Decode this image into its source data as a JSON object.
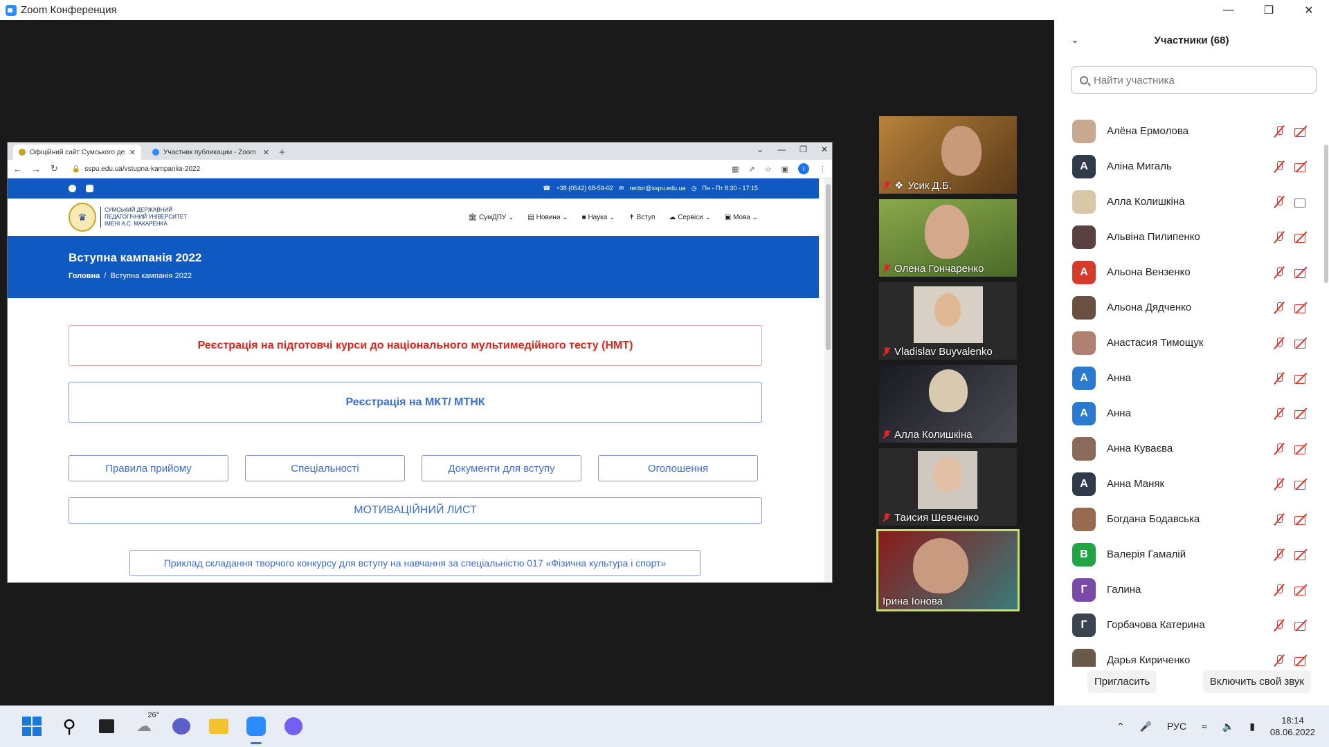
{
  "zoom": {
    "window_title": "Zoom Конференция"
  },
  "browser": {
    "tabs": [
      {
        "title": "Офіційний сайт Сумського держ",
        "color": "#c9a227"
      },
      {
        "title": "Участник публикации - Zoom",
        "color": "#2d8cff"
      }
    ],
    "url": "sspu.edu.ua/vstupna-kampaniia-2022",
    "profile_initial": "I"
  },
  "site": {
    "phone": "+38 (0542) 68-59-02",
    "email": "rector@sspu.edu.ua",
    "hours": "Пн - Пт 8:30 - 17:15",
    "logo_lines": [
      "СУМСЬКИЙ ДЕРЖАВНИЙ",
      "ПЕДАГОГІЧНИЙ УНІВЕРСИТЕТ",
      "ІМЕНІ А.С. МАКАРЕНКА"
    ],
    "menu": [
      "СумДПУ",
      "Новини",
      "Наука",
      "Вступ",
      "Сервіси",
      "Мова"
    ],
    "hero_title": "Вступна кампанія 2022",
    "crumb_home": "Головна",
    "crumb_sep": "/",
    "crumb_current": "Вступна кампанія 2022",
    "btn_nmt": "Реєстрація на підготовчі курси до національного мультимедійного тесту (НМТ)",
    "btn_mkt": "Реєстрація на МКТ/ МТНК",
    "btn_rules": "Правила прийому",
    "btn_specs": "Спеціальності",
    "btn_docs": "Документи для вступу",
    "btn_ann": "Оголошення",
    "btn_motiv": "МОТИВАЦІЙНИЙ ЛИСТ",
    "btn_example": "Приклад складання творчого конкурсу для вступу на навчання за спеціальністю 017 «Фізична культура і спорт»"
  },
  "videos": [
    {
      "name": "Усик Д.Б.",
      "bg": "#7a5a2a",
      "face": "#c9a080"
    },
    {
      "name": "Олена Гончаренко",
      "bg": "#6e8a3a",
      "face": "#d2a68a"
    },
    {
      "name": "Vladislav Buyvalenko",
      "bg": "#d8d0c4",
      "face": "#e0b896"
    },
    {
      "name": "Алла Колишкіна",
      "bg": "#2a2a30",
      "face": "#d9c9b0"
    },
    {
      "name": "Таисия Шевченко",
      "bg": "#cfc8c0",
      "face": "#e2c0a6"
    },
    {
      "name": "Ірина Іонова",
      "bg": "#3a7a7a",
      "face": "#c89a80"
    }
  ],
  "panel": {
    "title": "Участники (68)",
    "search_placeholder": "Найти участника",
    "invite": "Пригласить",
    "unmute_self": "Включить свой звук",
    "participants": [
      {
        "name": "Алёна Ермолова",
        "initial": "",
        "color": "#c8a890",
        "cam": "off"
      },
      {
        "name": "Аліна Мигаль",
        "initial": "A",
        "color": "#2f3a4a",
        "cam": "off"
      },
      {
        "name": "Алла Колишкіна",
        "initial": "",
        "color": "#d8c8a8",
        "cam": "on"
      },
      {
        "name": "Альвіна Пилипенко",
        "initial": "",
        "color": "#5a4040",
        "cam": "off"
      },
      {
        "name": "Альона Вензенко",
        "initial": "A",
        "color": "#d63a2a",
        "cam": "off"
      },
      {
        "name": "Альона Дядченко",
        "initial": "",
        "color": "#6a5040",
        "cam": "off"
      },
      {
        "name": "Анастасия Тимощук",
        "initial": "",
        "color": "#b08070",
        "cam": "off"
      },
      {
        "name": "Анна",
        "initial": "A",
        "color": "#2a7ad0",
        "cam": "off"
      },
      {
        "name": "Анна",
        "initial": "A",
        "color": "#2a7ad0",
        "cam": "off"
      },
      {
        "name": "Анна Куваєва",
        "initial": "",
        "color": "#8a6a5a",
        "cam": "off"
      },
      {
        "name": "Анна Маняк",
        "initial": "A",
        "color": "#2f3a4a",
        "cam": "off"
      },
      {
        "name": "Богдана Бодавська",
        "initial": "",
        "color": "#9a6a50",
        "cam": "off"
      },
      {
        "name": "Валерія Гамалій",
        "initial": "B",
        "color": "#22a344",
        "cam": "off"
      },
      {
        "name": "Галина",
        "initial": "Г",
        "color": "#7a4aa8",
        "cam": "off"
      },
      {
        "name": "Горбачова Катерина",
        "initial": "Г",
        "color": "#3a4450",
        "cam": "off"
      },
      {
        "name": "Дарья Кириченко",
        "initial": "",
        "color": "#6a5a4a",
        "cam": "off"
      }
    ]
  },
  "taskbar": {
    "weather": "26°",
    "lang": "РУС",
    "time": "18:14",
    "date": "08.06.2022"
  }
}
